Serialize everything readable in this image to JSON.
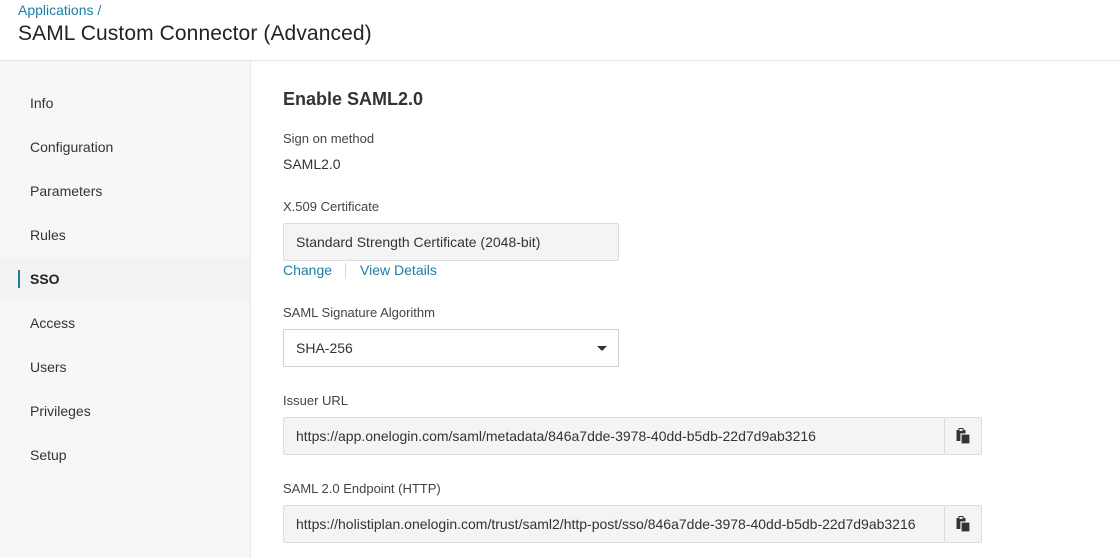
{
  "header": {
    "breadcrumb": "Applications /",
    "title": "SAML Custom Connector (Advanced)"
  },
  "sidebar": {
    "items": [
      {
        "label": "Info"
      },
      {
        "label": "Configuration"
      },
      {
        "label": "Parameters"
      },
      {
        "label": "Rules"
      },
      {
        "label": "SSO",
        "active": true
      },
      {
        "label": "Access"
      },
      {
        "label": "Users"
      },
      {
        "label": "Privileges"
      },
      {
        "label": "Setup"
      }
    ]
  },
  "main": {
    "section_title": "Enable SAML2.0",
    "sign_on": {
      "label": "Sign on method",
      "value": "SAML2.0"
    },
    "certificate": {
      "label": "X.509 Certificate",
      "value": "Standard Strength Certificate (2048-bit)",
      "change_link": "Change",
      "details_link": "View Details"
    },
    "signature_algorithm": {
      "label": "SAML Signature Algorithm",
      "value": "SHA-256"
    },
    "issuer_url": {
      "label": "Issuer URL",
      "value": "https://app.onelogin.com/saml/metadata/846a7dde-3978-40dd-b5db-22d7d9ab3216"
    },
    "endpoint_http": {
      "label": "SAML 2.0 Endpoint (HTTP)",
      "value": "https://holistiplan.onelogin.com/trust/saml2/http-post/sso/846a7dde-3978-40dd-b5db-22d7d9ab3216"
    }
  },
  "icons": {
    "copy": "clipboard-copy-icon",
    "dropdown": "caret-down-icon"
  },
  "colors": {
    "accent": "#1b7fa6"
  }
}
